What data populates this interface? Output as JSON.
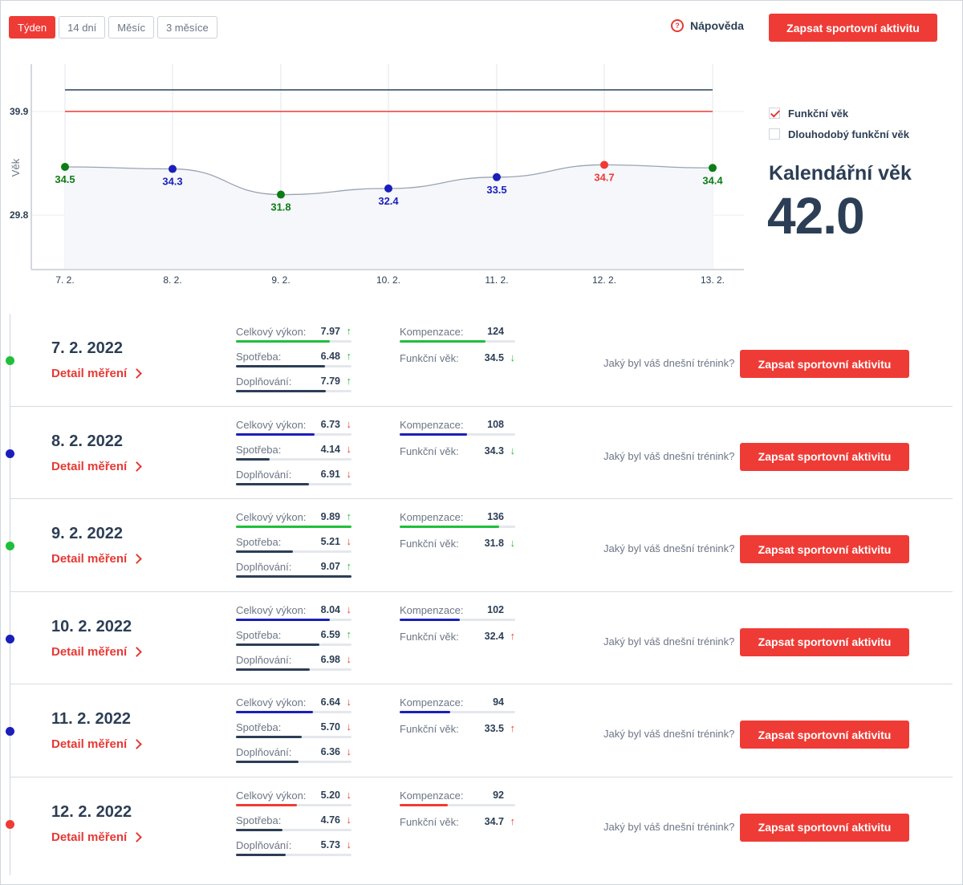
{
  "toolbar": {
    "periods": [
      "Týden",
      "14 dní",
      "Měsíc",
      "3 měsíce"
    ],
    "active_period": "Týden",
    "help_label": "Nápověda",
    "help_icon": "?",
    "cta_label": "Zapsat sportovní aktivitu"
  },
  "colors": {
    "accent": "#ef3b36",
    "green": "#1fbf3a",
    "blue": "#1a1fba",
    "red": "#ef3b36",
    "navy": "#2c3e55",
    "dark_green_text": "#0a7a12"
  },
  "chart_data": {
    "type": "line",
    "ylabel": "Věk",
    "xlabel": "",
    "x": [
      "7. 2.",
      "8. 2.",
      "9. 2.",
      "10. 2.",
      "11. 2.",
      "12. 2.",
      "13. 2."
    ],
    "series": [
      {
        "values": [
          34.5,
          34.3,
          31.8,
          32.4,
          33.5,
          34.7,
          34.4
        ],
        "point_colors": [
          "green",
          "blue",
          "green",
          "blue",
          "blue",
          "red",
          "green"
        ]
      }
    ],
    "y_tick_labels": [
      "39.9",
      "29.8"
    ],
    "y_ticks": [
      39.9,
      29.8
    ],
    "reference_lines": [
      {
        "value": 42.0,
        "color": "#2c3e55"
      },
      {
        "value": 39.9,
        "color": "#ef3b36"
      },
      {
        "value": 29.8,
        "color": "#1fbf3a"
      }
    ],
    "ylim": [
      24.5,
      44.5
    ],
    "grid": true
  },
  "legend": {
    "items": [
      {
        "label": "Funkční věk",
        "checked": true
      },
      {
        "label": "Dlouhodobý funkční věk",
        "checked": false
      }
    ]
  },
  "calendar_age": {
    "label": "Kalendářní věk",
    "value": "42.0"
  },
  "rows": [
    {
      "date": "7. 2. 2022",
      "detail": "Detail měření",
      "dot": "green",
      "metrics": {
        "celkovy": {
          "label": "Celkový výkon:",
          "value": "7.97",
          "trend": "up",
          "fill": 0.81,
          "color": "green"
        },
        "spotreba": {
          "label": "Spotřeba:",
          "value": "6.48",
          "trend": "up",
          "fill": 0.77,
          "color": "navy"
        },
        "doplnovani": {
          "label": "Doplňování:",
          "value": "7.79",
          "trend": "up",
          "fill": 0.78,
          "color": "navy"
        },
        "kompenzace": {
          "label": "Kompenzace:",
          "value": "124",
          "fill": 0.74,
          "color": "green"
        },
        "funkcni": {
          "label": "Funkční věk:",
          "value": "34.5",
          "trend": "down-good"
        }
      },
      "question": "Jaký byl váš dnešní trénink?",
      "cta": "Zapsat sportovní aktivitu"
    },
    {
      "date": "8. 2. 2022",
      "detail": "Detail měření",
      "dot": "blue",
      "metrics": {
        "celkovy": {
          "label": "Celkový výkon:",
          "value": "6.73",
          "trend": "down",
          "fill": 0.68,
          "color": "blue"
        },
        "spotreba": {
          "label": "Spotřeba:",
          "value": "4.14",
          "trend": "down",
          "fill": 0.29,
          "color": "navy"
        },
        "doplnovani": {
          "label": "Doplňování:",
          "value": "6.91",
          "trend": "down",
          "fill": 0.63,
          "color": "navy"
        },
        "kompenzace": {
          "label": "Kompenzace:",
          "value": "108",
          "fill": 0.58,
          "color": "blue"
        },
        "funkcni": {
          "label": "Funkční věk:",
          "value": "34.3",
          "trend": "down-good"
        }
      },
      "question": "Jaký byl váš dnešní trénink?",
      "cta": "Zapsat sportovní aktivitu"
    },
    {
      "date": "9. 2. 2022",
      "detail": "Detail měření",
      "dot": "green",
      "metrics": {
        "celkovy": {
          "label": "Celkový výkon:",
          "value": "9.89",
          "trend": "up",
          "fill": 1.0,
          "color": "green"
        },
        "spotreba": {
          "label": "Spotřeba:",
          "value": "5.21",
          "trend": "down",
          "fill": 0.49,
          "color": "navy"
        },
        "doplnovani": {
          "label": "Doplňování:",
          "value": "9.07",
          "trend": "up",
          "fill": 1.0,
          "color": "navy"
        },
        "kompenzace": {
          "label": "Kompenzace:",
          "value": "136",
          "fill": 0.86,
          "color": "green"
        },
        "funkcni": {
          "label": "Funkční věk:",
          "value": "31.8",
          "trend": "down-good"
        }
      },
      "question": "Jaký byl váš dnešní trénink?",
      "cta": "Zapsat sportovní aktivitu"
    },
    {
      "date": "10. 2. 2022",
      "detail": "Detail měření",
      "dot": "blue",
      "metrics": {
        "celkovy": {
          "label": "Celkový výkon:",
          "value": "8.04",
          "trend": "down",
          "fill": 0.81,
          "color": "blue"
        },
        "spotreba": {
          "label": "Spotřeba:",
          "value": "6.59",
          "trend": "up",
          "fill": 0.72,
          "color": "navy"
        },
        "doplnovani": {
          "label": "Doplňování:",
          "value": "6.98",
          "trend": "down",
          "fill": 0.64,
          "color": "navy"
        },
        "kompenzace": {
          "label": "Kompenzace:",
          "value": "102",
          "fill": 0.52,
          "color": "blue"
        },
        "funkcni": {
          "label": "Funkční věk:",
          "value": "32.4",
          "trend": "up-bad"
        }
      },
      "question": "Jaký byl váš dnešní trénink?",
      "cta": "Zapsat sportovní aktivitu"
    },
    {
      "date": "11. 2. 2022",
      "detail": "Detail měření",
      "dot": "blue",
      "metrics": {
        "celkovy": {
          "label": "Celkový výkon:",
          "value": "6.64",
          "trend": "down",
          "fill": 0.67,
          "color": "blue"
        },
        "spotreba": {
          "label": "Spotřeba:",
          "value": "5.70",
          "trend": "down",
          "fill": 0.57,
          "color": "navy"
        },
        "doplnovani": {
          "label": "Doplňování:",
          "value": "6.36",
          "trend": "down",
          "fill": 0.54,
          "color": "navy"
        },
        "kompenzace": {
          "label": "Kompenzace:",
          "value": "94",
          "fill": 0.44,
          "color": "blue"
        },
        "funkcni": {
          "label": "Funkční věk:",
          "value": "33.5",
          "trend": "up-bad"
        }
      },
      "question": "Jaký byl váš dnešní trénink?",
      "cta": "Zapsat sportovní aktivitu"
    },
    {
      "date": "12. 2. 2022",
      "detail": "Detail měření",
      "dot": "red",
      "metrics": {
        "celkovy": {
          "label": "Celkový výkon:",
          "value": "5.20",
          "trend": "down",
          "fill": 0.53,
          "color": "red"
        },
        "spotreba": {
          "label": "Spotřeba:",
          "value": "4.76",
          "trend": "down",
          "fill": 0.4,
          "color": "navy"
        },
        "doplnovani": {
          "label": "Doplňování:",
          "value": "5.73",
          "trend": "down",
          "fill": 0.43,
          "color": "navy"
        },
        "kompenzace": {
          "label": "Kompenzace:",
          "value": "92",
          "fill": 0.42,
          "color": "red"
        },
        "funkcni": {
          "label": "Funkční věk:",
          "value": "34.7",
          "trend": "up-bad"
        }
      },
      "question": "Jaký byl váš dnešní trénink?",
      "cta": "Zapsat sportovní aktivitu"
    }
  ]
}
